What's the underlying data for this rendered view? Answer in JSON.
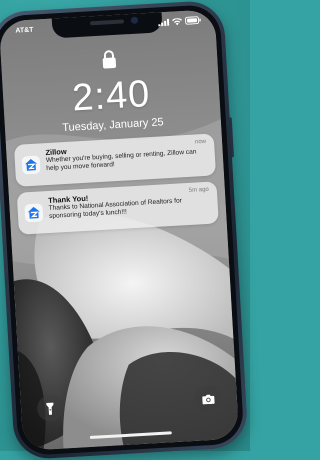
{
  "status_bar": {
    "carrier": "AT&T"
  },
  "lock_screen": {
    "time": "2:40",
    "date": "Tuesday, January 25"
  },
  "notifications": [
    {
      "app_icon": "zillow-icon",
      "title": "Zillow",
      "time": "now",
      "body": "Whether you're buying, selling or renting, Zillow can help you move forward!"
    },
    {
      "app_icon": "zillow-icon",
      "title": "Thank You!",
      "time": "5m ago",
      "body": "Thanks to National Association of Realtors for sponsoring today's lunch!!!"
    }
  ],
  "quick_actions": {
    "left": "flashlight-icon",
    "right": "camera-icon"
  },
  "colors": {
    "background": "#35a3a3",
    "frame": "#2a3647",
    "zillow_blue": "#1d74e7"
  }
}
